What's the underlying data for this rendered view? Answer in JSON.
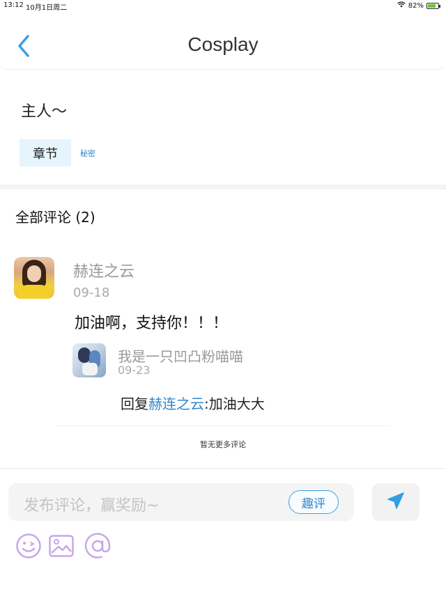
{
  "status_bar": {
    "time": "13:12",
    "date": "10月1日周二",
    "battery": "82%",
    "battery_level": 0.82
  },
  "nav": {
    "title": "Cosplay",
    "back_icon": "chevron-left-icon"
  },
  "post": {
    "text": "主人～",
    "tag": "章节",
    "secret_link": "秘密"
  },
  "comments": {
    "heading": "全部评论 (2)",
    "items": [
      {
        "user": "赫连之云",
        "date": "09-18",
        "text": "加油啊，支持你！！！",
        "replies": [
          {
            "user": "我是一只凹凸粉喵喵",
            "date": "09-23",
            "reply_prefix": "回复",
            "mention": "赫连之云",
            "reply_text": ":加油大大"
          }
        ]
      }
    ],
    "no_more": "暂无更多评论"
  },
  "composer": {
    "placeholder": "发布评论，赢奖励~",
    "quping_label": "趣评",
    "send_icon": "send-icon",
    "tools": [
      "emoji-icon",
      "image-icon",
      "mention-icon"
    ]
  },
  "colors": {
    "accent": "#2f86c9",
    "tool_icon": "#c8a6ea",
    "tag_bg": "#e6f4fd"
  }
}
